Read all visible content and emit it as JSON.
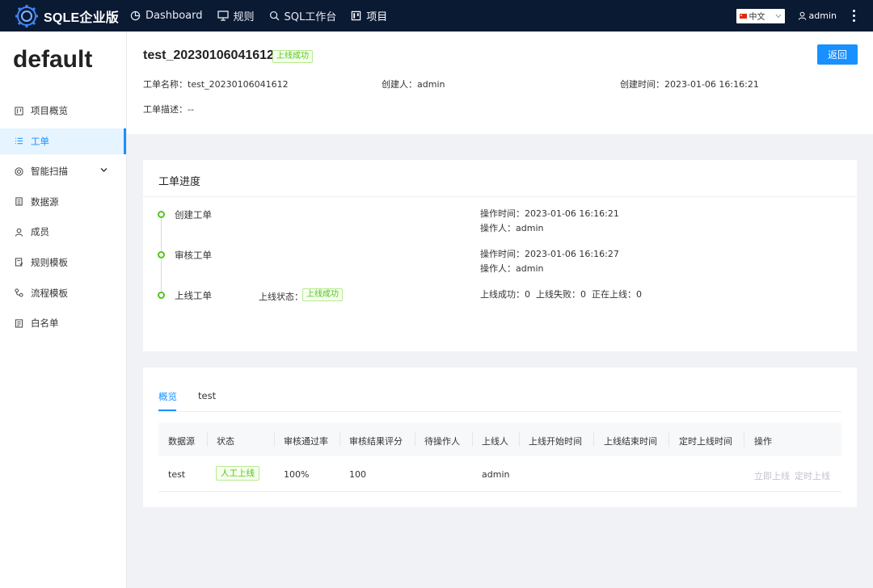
{
  "brand": "SQLE企业版",
  "nav": [
    {
      "label": "Dashboard",
      "icon": "pie-chart-icon"
    },
    {
      "label": "规则",
      "icon": "monitor-icon"
    },
    {
      "label": "SQL工作台",
      "icon": "search-icon"
    },
    {
      "label": "项目",
      "icon": "project-icon"
    }
  ],
  "language": "中文",
  "user": "admin",
  "project_name": "default",
  "sidebar": {
    "items": [
      {
        "label": "项目概览",
        "icon": "overview-icon"
      },
      {
        "label": "工单",
        "icon": "list-icon"
      },
      {
        "label": "智能扫描",
        "icon": "scan-icon"
      },
      {
        "label": "数据源",
        "icon": "database-icon"
      },
      {
        "label": "成员",
        "icon": "user-icon"
      },
      {
        "label": "规则模板",
        "icon": "rule-template-icon"
      },
      {
        "label": "流程模板",
        "icon": "flow-template-icon"
      },
      {
        "label": "白名单",
        "icon": "whitelist-icon"
      }
    ]
  },
  "order": {
    "title": "test_20230106041612",
    "status_tag": "上线成功",
    "back_label": "返回",
    "name_label": "工单名称：",
    "name_value": "test_20230106041612",
    "creator_label": "创建人：",
    "creator_value": "admin",
    "created_label": "创建时间：",
    "created_value": "2023-01-06 16:16:21",
    "desc_label": "工单描述：",
    "desc_value": "--"
  },
  "progress": {
    "title": "工单进度",
    "steps": [
      {
        "label": "创建工单",
        "time": "操作时间：2023-01-06 16:16:21",
        "operator": "操作人：admin"
      },
      {
        "label": "审核工单",
        "time": "操作时间：2023-01-06 16:16:27",
        "operator": "操作人：admin"
      },
      {
        "label": "上线工单",
        "status_label": "上线状态：",
        "status_tag": "上线成功",
        "summary": "上线成功：0  上线失败：0  正在上线：0"
      }
    ]
  },
  "detail": {
    "tabs": [
      "概览",
      "test"
    ],
    "columns": [
      "数据源",
      "状态",
      "审核通过率",
      "审核结果评分",
      "待操作人",
      "上线人",
      "上线开始时间",
      "上线结束时间",
      "定时上线时间",
      "操作"
    ],
    "rows": [
      {
        "datasource": "test",
        "status": "人工上线",
        "pass_rate": "100%",
        "score": "100",
        "pending": "",
        "executor": "admin",
        "start": "",
        "end": "",
        "scheduled": "",
        "action_now": "立即上线",
        "action_schedule": "定时上线"
      }
    ]
  },
  "colors": {
    "topbar": "#0b1a33",
    "accent": "#1890ff",
    "success": "#52c41a"
  }
}
